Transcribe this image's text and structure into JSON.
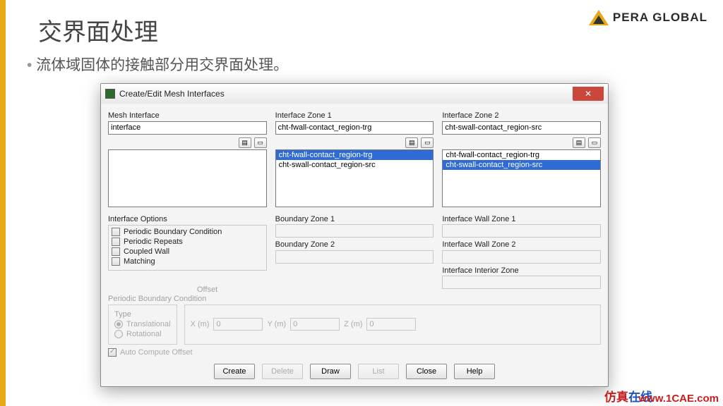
{
  "slide": {
    "title": "交界面处理",
    "subtitle": "流体域固体的接触部分用交界面处理。",
    "logo_text": "PERA GLOBAL",
    "watermark": "1CAE.COM"
  },
  "dialog": {
    "title": "Create/Edit Mesh Interfaces",
    "labels": {
      "mesh_interface": "Mesh Interface",
      "zone1": "Interface Zone 1",
      "zone2": "Interface Zone 2",
      "options": "Interface Options",
      "b1": "Boundary Zone 1",
      "b2": "Boundary Zone 2",
      "w1": "Interface Wall Zone 1",
      "w2": "Interface Wall Zone 2",
      "interior": "Interface Interior Zone",
      "pbc": "Periodic Boundary Condition",
      "type": "Type",
      "offset": "Offset",
      "xm": "X (m)",
      "ym": "Y (m)",
      "zm": "Z (m)",
      "auto": "Auto Compute Offset"
    },
    "inputs": {
      "mesh_interface": "interface",
      "zone1": "cht-fwall-contact_region-trg",
      "zone2": "cht-swall-contact_region-src",
      "x": "0",
      "y": "0",
      "z": "0"
    },
    "lists": {
      "zone1_items": [
        "cht-fwall-contact_region-trg",
        "cht-swall-contact_region-src"
      ],
      "zone1_selected": 0,
      "zone2_items": [
        "cht-fwall-contact_region-trg",
        "cht-swall-contact_region-src"
      ],
      "zone2_selected": 1
    },
    "options": [
      "Periodic Boundary Condition",
      "Periodic Repeats",
      "Coupled Wall",
      "Matching"
    ],
    "radios": [
      "Translational",
      "Rotational"
    ],
    "buttons": {
      "create": "Create",
      "delete": "Delete",
      "draw": "Draw",
      "list": "List",
      "close": "Close",
      "help": "Help"
    }
  },
  "footer": {
    "cn_a": "仿真",
    "cn_b": "在线",
    "url": "www.1CAE.com"
  }
}
